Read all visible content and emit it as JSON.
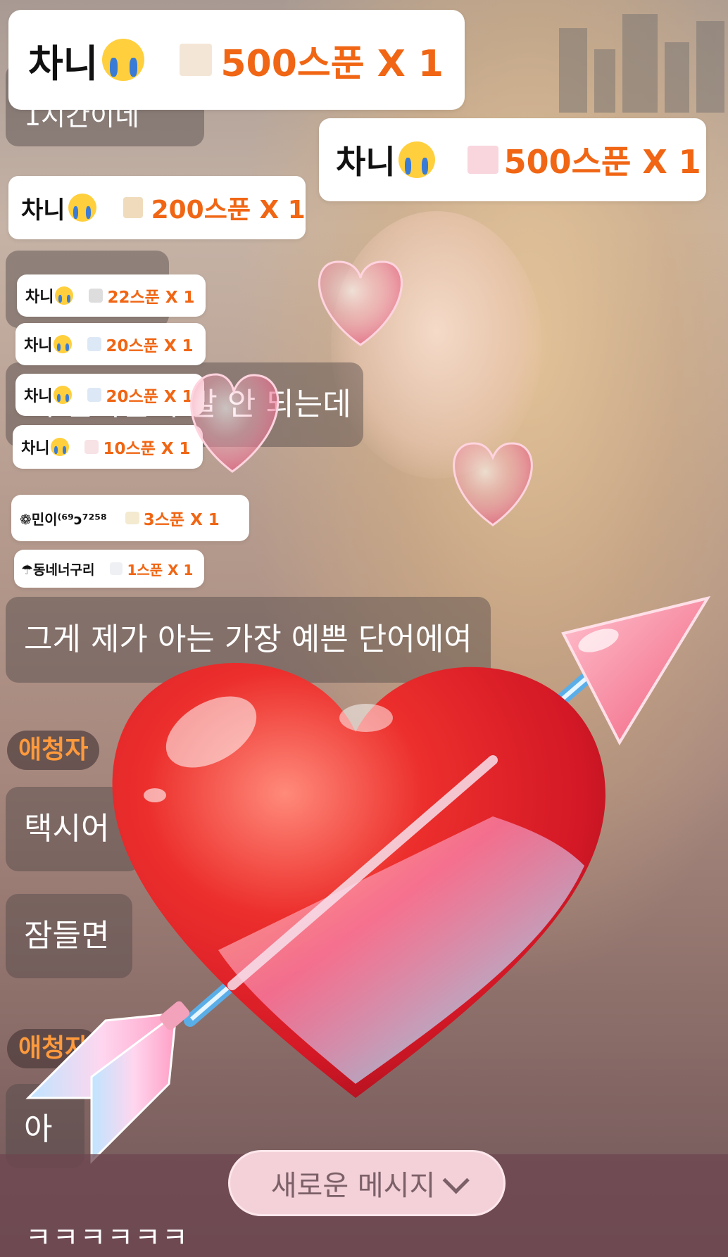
{
  "chat": {
    "partial_top": "1시간이네",
    "msg_1": "이 한다는거 말 안 되는데",
    "msg_2": "그게 제가 아는 가장 예쁜 단어에여",
    "viewer_label": "애청자",
    "msg_3": "택시어",
    "msg_4": "잠들면",
    "viewer_label_2": "애청자",
    "msg_5": "아",
    "last_message": "ㅋㅋㅋㅋㅋㅋ"
  },
  "gifts": [
    {
      "user": "차니",
      "icon": "cake-gift-icon",
      "amount": "500스푼 X 1"
    },
    {
      "user": "차니",
      "icon": "heart-arrow-gift-icon",
      "amount": "500스푼 X 1"
    },
    {
      "user": "차니",
      "icon": "bear-gift-icon",
      "amount": "200스푼 X 1"
    },
    {
      "user": "차니",
      "icon": "cat-gift-icon",
      "amount": "22스푼 X 1"
    },
    {
      "user": "차니",
      "icon": "sparkle-gift-icon",
      "amount": "20스푼 X 1"
    },
    {
      "user": "차니",
      "icon": "sparkle-gift-icon",
      "amount": "20스푼 X 1"
    },
    {
      "user": "차니",
      "icon": "rabbit-gift-icon",
      "amount": "10스푼 X 1"
    },
    {
      "user": "❁민이⁽⁶⁹ᴐ⁷²⁵⁸",
      "icon": "cloud-gift-icon",
      "amount": "3스푼 X 1"
    },
    {
      "user": "☂동네너구리",
      "icon": "star-gift-icon",
      "amount": "1스푼 X 1"
    }
  ],
  "new_message_button": "새로운 메시지",
  "colors": {
    "amount": "#f06614",
    "viewer_tag": "#ff9a3c",
    "new_message_bg": "#f4d1d9",
    "heart": "#e62a2a"
  }
}
